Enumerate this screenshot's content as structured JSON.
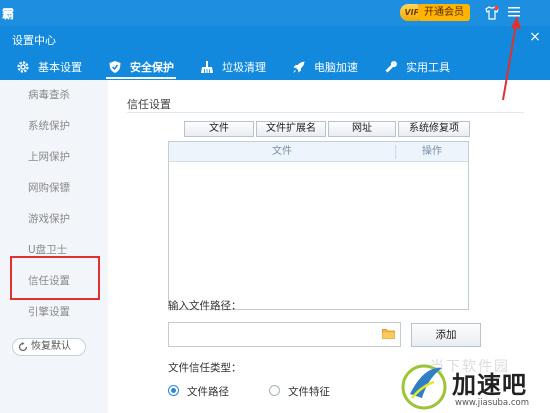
{
  "app_bar": {
    "brand": "霸",
    "vip_badge": "VIP",
    "vip_button": "开通会员"
  },
  "window": {
    "title": "设置中心",
    "close_label": "×"
  },
  "tabs": [
    {
      "label": "基本设置",
      "icon": "gear-icon",
      "active": false
    },
    {
      "label": "安全保护",
      "icon": "shield-icon",
      "active": true
    },
    {
      "label": "垃圾清理",
      "icon": "broom-icon",
      "active": false
    },
    {
      "label": "电脑加速",
      "icon": "rocket-icon",
      "active": false
    },
    {
      "label": "实用工具",
      "icon": "wrench-icon",
      "active": false
    }
  ],
  "sidebar": {
    "items": [
      {
        "label": "病毒查杀"
      },
      {
        "label": "系统保护"
      },
      {
        "label": "上网保护"
      },
      {
        "label": "网购保镖"
      },
      {
        "label": "游戏保护"
      },
      {
        "label": "U盘卫士"
      },
      {
        "label": "信任设置",
        "selected": true
      },
      {
        "label": "引擎设置"
      }
    ],
    "restore_label": "恢复默认"
  },
  "main": {
    "section_title": "信任设置",
    "filter_buttons": [
      "文件",
      "文件扩展名",
      "网址",
      "系统修复项"
    ],
    "table": {
      "col_file": "文件",
      "col_action": "操作",
      "rows": []
    },
    "path_label": "输入文件路径：",
    "path_value": "",
    "add_label": "添加",
    "trust_type_label": "文件信任类型：",
    "radio_path": "文件路径",
    "radio_feature": "文件特征",
    "selected_radio": "文件路径"
  },
  "watermark": {
    "faint": "当下软件园",
    "brand": "加速吧",
    "url": "www.jiasuba.com"
  },
  "colors": {
    "header_blue": "#1389de",
    "annotation_red": "#e03030",
    "vip_gold": "#ffb400"
  }
}
